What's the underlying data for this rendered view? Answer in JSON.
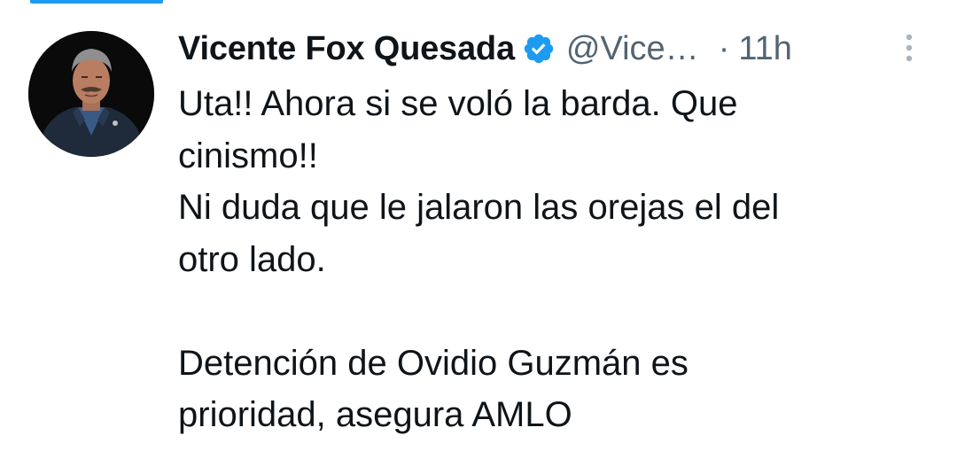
{
  "tweet": {
    "author": {
      "display_name": "Vicente Fox Quesada",
      "verified": true,
      "handle": "@Vice…"
    },
    "separator": "·",
    "time": "11h",
    "text": "Uta!! Ahora si se voló la barda. Que\ncinismo!!\nNi duda que le jalaron las orejas el del\notro lado.\n\nDetención de Ovidio Guzmán es\nprioridad, asegura AMLO"
  },
  "icons": {
    "verified": "verified-badge-icon",
    "more": "more-options-icon"
  },
  "colors": {
    "accent": "#1d9bf0",
    "text_primary": "#0f1419",
    "text_secondary": "#536471"
  }
}
